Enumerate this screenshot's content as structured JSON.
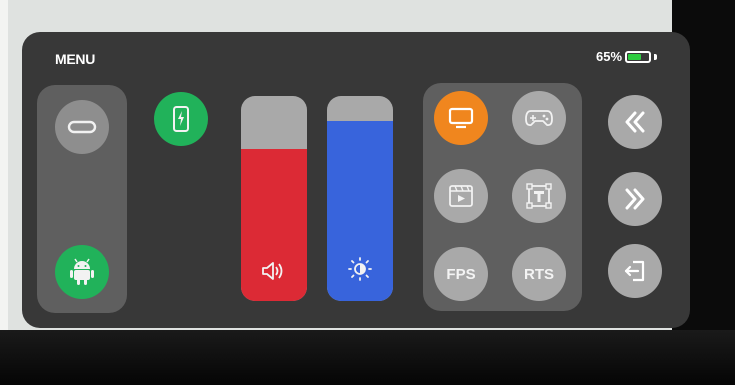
{
  "menu": {
    "title": "MENU"
  },
  "battery": {
    "percent_label": "65%",
    "level": 0.65,
    "color": "#2ecc40"
  },
  "left_group": {
    "items": [
      {
        "icon": "usb-c-port-icon",
        "interactable": true
      },
      {
        "icon": "android-icon",
        "interactable": true
      }
    ]
  },
  "charging_button": {
    "icon": "phone-charging-icon"
  },
  "volume_slider": {
    "icon": "speaker-volume-icon",
    "level": 0.74,
    "color": "#dc2a35"
  },
  "brightness_slider": {
    "icon": "brightness-icon",
    "level": 0.88,
    "color": "#3864dc"
  },
  "modes": [
    {
      "icon": "monitor-icon",
      "label": "",
      "selected": true
    },
    {
      "icon": "gamepad-icon",
      "label": "",
      "selected": false
    },
    {
      "icon": "video-player-icon",
      "label": "",
      "selected": false
    },
    {
      "icon": "text-box-icon",
      "label": "",
      "selected": false
    },
    {
      "icon": "",
      "label": "FPS",
      "selected": false
    },
    {
      "icon": "",
      "label": "RTS",
      "selected": false
    }
  ],
  "nav": [
    {
      "icon": "double-chevron-left-icon"
    },
    {
      "icon": "double-chevron-right-icon"
    },
    {
      "icon": "exit-icon"
    }
  ]
}
